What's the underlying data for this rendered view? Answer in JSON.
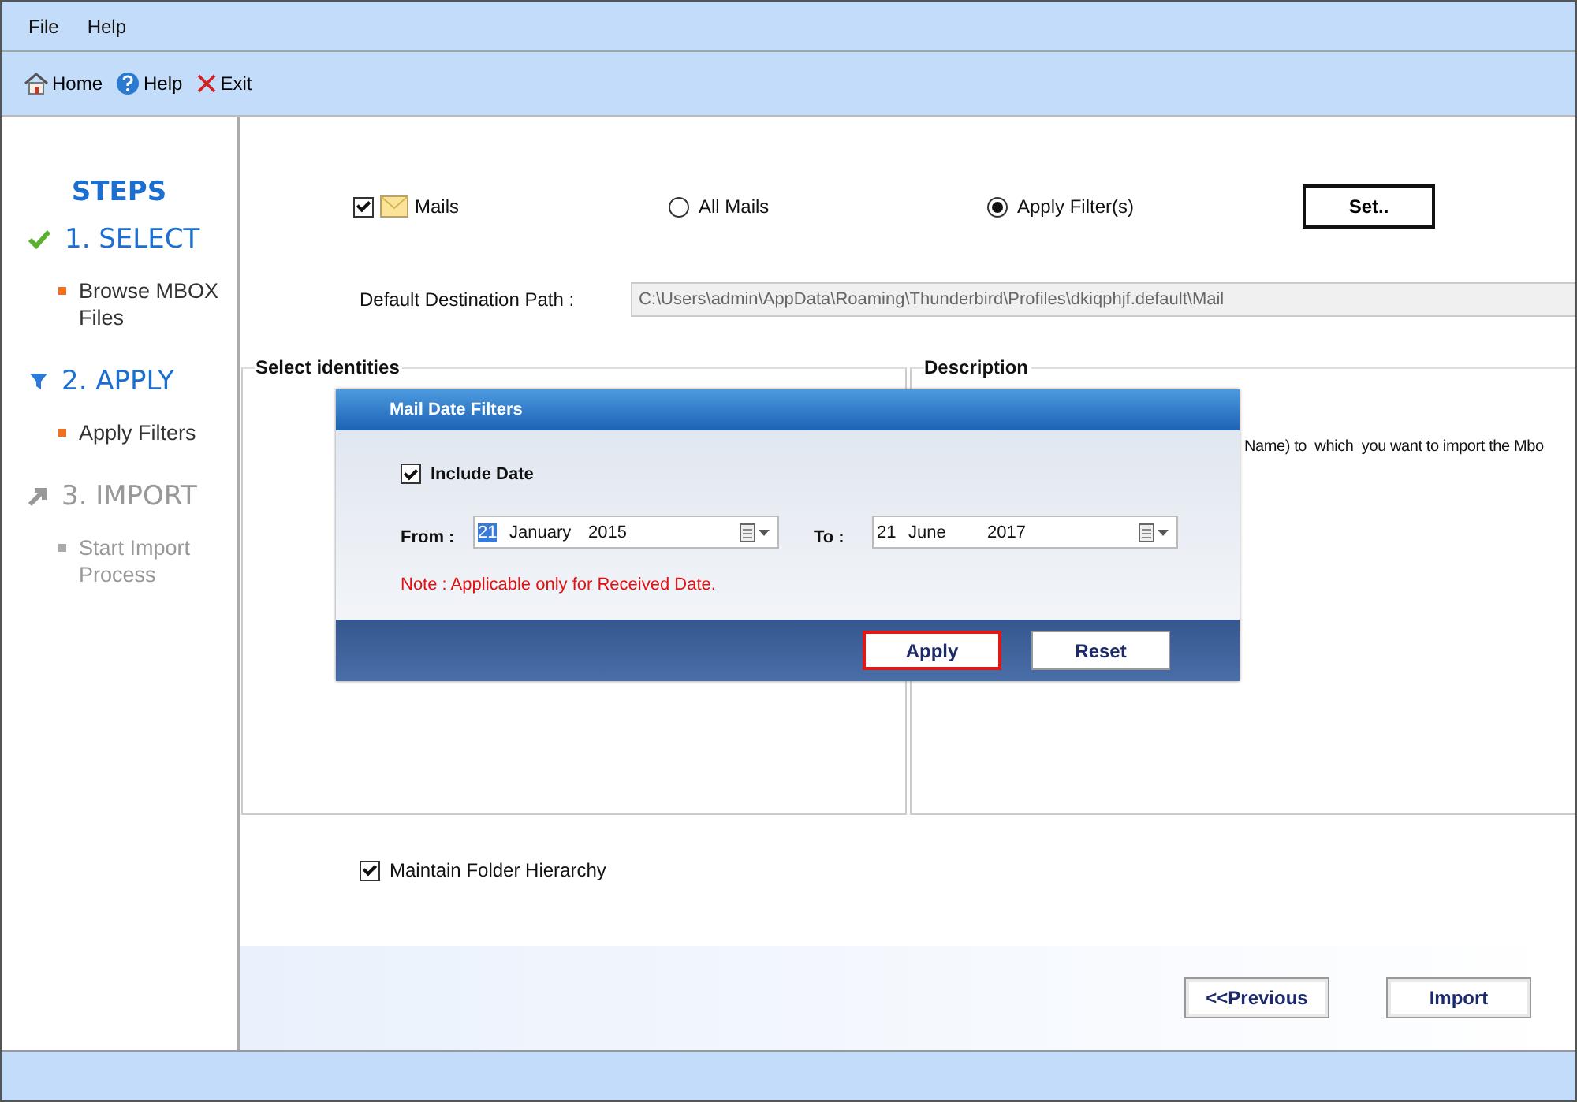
{
  "menu": [
    "File",
    "Help"
  ],
  "toolbar": [
    {
      "label": "Home",
      "kind": "home"
    },
    {
      "label": "Help",
      "kind": "help"
    },
    {
      "label": "Exit",
      "kind": "exit"
    }
  ],
  "steps_title": "STEPS",
  "steps": [
    {
      "label": "1. SELECT",
      "kind": "check",
      "enabled": true,
      "sub": "Browse MBOX Files"
    },
    {
      "label": "2. APPLY",
      "kind": "filter",
      "enabled": true,
      "sub": "Apply Filters"
    },
    {
      "label": "3. IMPORT",
      "kind": "arrow",
      "enabled": false,
      "sub": "Start Import Process"
    }
  ],
  "mails": {
    "label": "Mails",
    "checked": true
  },
  "mode_options": [
    {
      "label": "All Mails",
      "selected": false
    },
    {
      "label": "Apply Filter(s)",
      "selected": true
    }
  ],
  "set_button": "Set..",
  "path": {
    "label": "Default Destination Path :",
    "value": "C:\\Users\\admin\\AppData\\Roaming\\Thunderbird\\Profiles\\dkiqphjf.default\\Mail"
  },
  "identities_title": "Select identities",
  "description": {
    "title": "Description",
    "text": "Name) to  which  you want to import the Mbo"
  },
  "maintain": {
    "label": "Maintain Folder Hierarchy",
    "checked": true
  },
  "buttons": [
    "<<Previous",
    "Import"
  ],
  "dialog": {
    "title": "Mail Date Filters",
    "include": {
      "label": "Include Date",
      "checked": true
    },
    "from": {
      "label": "From :",
      "day": "21",
      "month": "January",
      "year": "2015"
    },
    "to": {
      "label": "To :",
      "day": "21",
      "month": "June",
      "year": "2017"
    },
    "note": "Note : Applicable only for Received Date.",
    "buttons": [
      {
        "label": "Apply",
        "selected": true
      },
      {
        "label": "Reset",
        "selected": false
      }
    ]
  }
}
